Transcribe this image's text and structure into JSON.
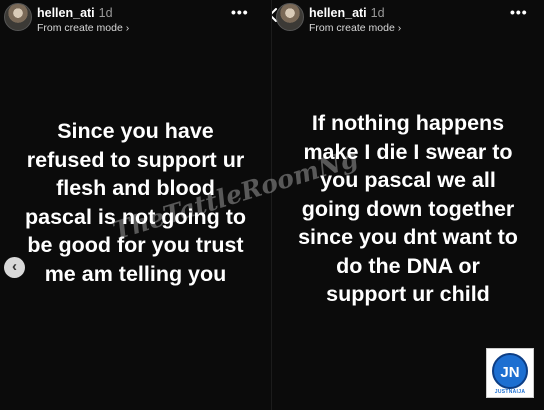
{
  "stories": [
    {
      "username": "hellen_ati",
      "time": "1d",
      "subtitle": "From create mode ›",
      "more_icon": "more-horizontal-icon",
      "text": "Since you have\nrefused to support ur\nflesh and blood\npascal is not going to\nbe good for you trust\nme am telling you"
    },
    {
      "username": "hellen_ati",
      "time": "1d",
      "subtitle": "From create mode ›",
      "more_icon": "more-horizontal-icon",
      "text": "If nothing happens\nmake I die I swear to\nyou pascal we all\ngoing down together\nsince you dnt want to\ndo the DNA or\nsupport ur child"
    }
  ],
  "watermark": "TheTattleRoomNg",
  "logo": {
    "letters": "JN",
    "caption": "JUSTNAIJA"
  },
  "nav": {
    "prev_glyph": "‹"
  },
  "colors": {
    "background": "#0b0b0b",
    "text": "#ffffff",
    "logo_blue": "#1d6fd1"
  }
}
